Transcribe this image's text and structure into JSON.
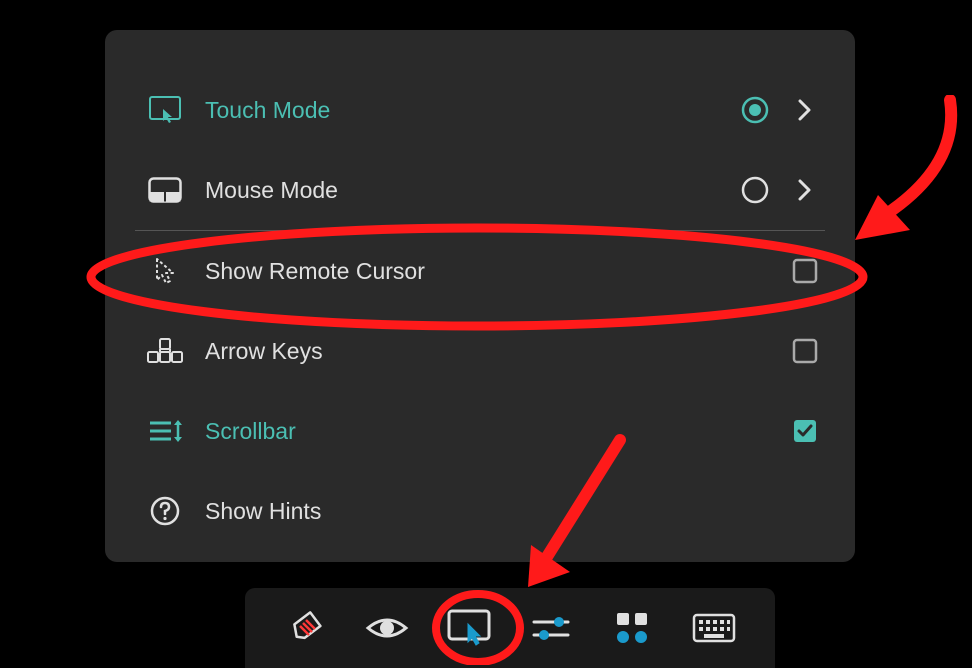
{
  "accent_color": "#4bbfb3",
  "annotation_color": "#ff1a1a",
  "menu": {
    "items": [
      {
        "label": "Touch Mode",
        "icon": "touch-mode",
        "selected": true,
        "expandable": true
      },
      {
        "label": "Mouse Mode",
        "icon": "mouse-mode",
        "selected": false,
        "expandable": true
      },
      {
        "label": "Show Remote Cursor",
        "icon": "remote-cursor",
        "checked": false
      },
      {
        "label": "Arrow Keys",
        "icon": "arrow-keys",
        "checked": false
      },
      {
        "label": "Scrollbar",
        "icon": "scrollbar",
        "checked": true
      },
      {
        "label": "Show Hints",
        "icon": "help-circle"
      }
    ]
  },
  "toolbar": {
    "items": [
      {
        "name": "eraser"
      },
      {
        "name": "eye"
      },
      {
        "name": "touch-cursor",
        "active": true
      },
      {
        "name": "sliders"
      },
      {
        "name": "grid-apps"
      },
      {
        "name": "keyboard"
      }
    ]
  },
  "annotations": {
    "ellipse_targets": [
      "Show Remote Cursor menu item",
      "touch-cursor toolbar button"
    ],
    "arrow_targets": [
      "touch-cursor toolbar button",
      "Show Remote Cursor checkbox"
    ]
  }
}
